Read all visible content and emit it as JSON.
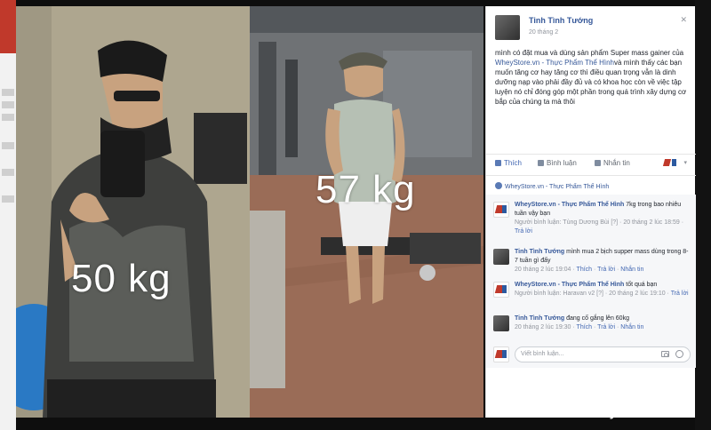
{
  "before_photo": {
    "weight": "50 kg"
  },
  "after_photo": {
    "weight": "57 kg"
  },
  "post": {
    "author": "Tinh Tình Tướng",
    "date": "20 tháng 2",
    "text_1": "mình có đặt mua và dùng sản phẩm Super mass gainer của ",
    "text_link": "WheyStore.vn - Thực Phẩm Thể Hình",
    "text_2": "và mình thấy các bạn muốn tăng cơ hay tăng cơ thì điều quan trọng vẫn là dinh dưỡng nạp vào phải đầy đủ và có khoa học còn về việc tập luyện nó chỉ đóng góp một phần trong quá trình xây dựng cơ bắp của chúng ta mà thôi"
  },
  "actions": {
    "like": "Thích",
    "comment": "Bình luận",
    "message": "Nhắn tin"
  },
  "page_like": "WheyStore.vn - Thực Phẩm Thể Hình",
  "comments": [
    {
      "name": "WheyStore.vn - Thực Phẩm Thể Hình",
      "text": " 7kg trong bao nhiêu tuần vậy bạn",
      "meta_prefix": "Người bình luận: Tùng Dương Bùi [?] · 20 tháng 2 lúc 18:59 · ",
      "reply": "Trả lời"
    },
    {
      "name": "Tinh Tình Tướng",
      "text": " mình mua 2 bịch supper mass dùng trong 8-7 tuần gì đấy",
      "meta_prefix": "20 tháng 2 lúc 19:04 · ",
      "like": "Thích",
      "reply": "Trả lời",
      "message": "Nhắn tin"
    },
    {
      "name": "WheyStore.vn - Thực Phẩm Thể Hình",
      "text": " tốt quá bạn",
      "meta_prefix": "Người bình luận: Haravan v2 [?] · 20 tháng 2 lúc 19:10 · ",
      "reply": "Trả lời"
    },
    {
      "name": "Tinh Tình Tướng",
      "text": " đang cố gắng lên 60kg",
      "meta_prefix": "20 tháng 2 lúc 19:30 · ",
      "like": "Thích",
      "reply": "Trả lời",
      "message": "Nhắn tin"
    }
  ],
  "reply_placeholder": "Viết bình luận...",
  "watermark": "WheyStore.vn"
}
